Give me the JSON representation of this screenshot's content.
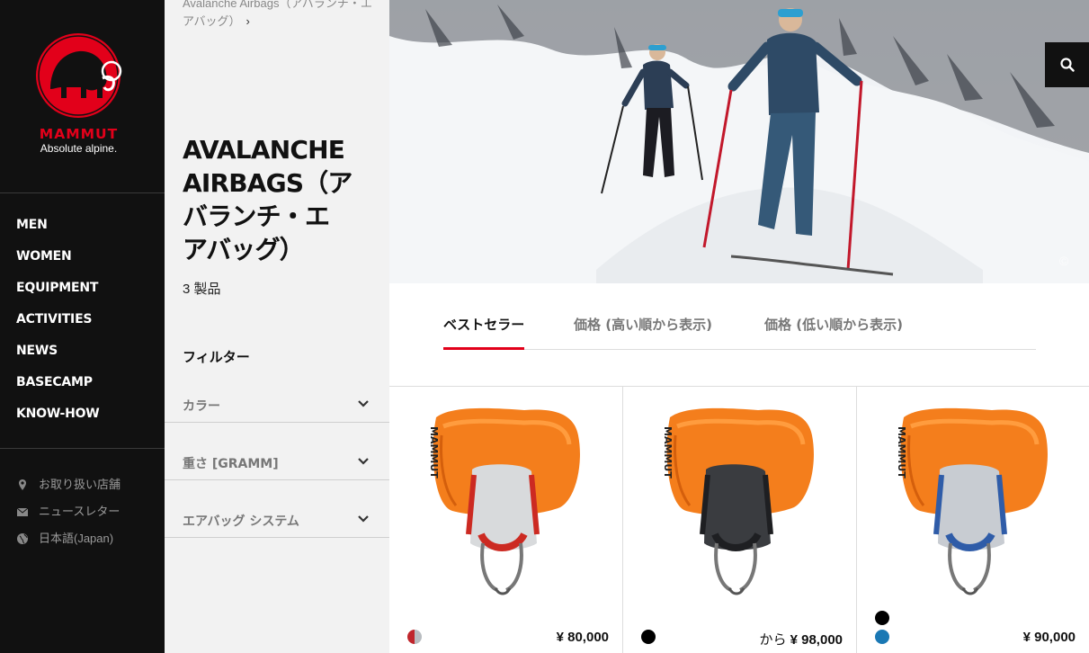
{
  "brand": {
    "name": "MAMMUT",
    "tagline": "Absolute alpine."
  },
  "nav": [
    "MEN",
    "WOMEN",
    "EQUIPMENT",
    "ACTIVITIES",
    "NEWS",
    "BASECAMP",
    "KNOW-HOW"
  ],
  "utility": [
    {
      "label": "お取り扱い店舗",
      "icon": "location-pin-icon"
    },
    {
      "label": "ニュースレター",
      "icon": "envelope-icon"
    },
    {
      "label": "日本語(Japan)",
      "icon": "globe-icon"
    }
  ],
  "breadcrumb": {
    "line1": "Avalanche Airbags（アバランチ・エ",
    "line2": "アバッグ）"
  },
  "category": {
    "title_line1": "AVALANCHE",
    "title_line2": "AIRBAGS（ア",
    "title_line3": "バランチ・エ",
    "title_line4": "アバッグ）",
    "count": "3 製品"
  },
  "filters": {
    "heading": "フィルター",
    "facets": [
      "カラー",
      "重さ [GRAMM]",
      "エアバッグ システム"
    ]
  },
  "hero": {
    "copyright": "©"
  },
  "sort": {
    "tabs": [
      "ベストセラー",
      "価格 (高い順から表示)",
      "価格 (低い順から表示)"
    ],
    "active": 0
  },
  "products": [
    {
      "price": "¥ 80,000",
      "prefix": "",
      "harness": "#d8dadc",
      "accent": "#cc2a22",
      "swatches": [
        "#c0262c|#b8bcc0"
      ]
    },
    {
      "price": "¥ 98,000",
      "prefix": "から ",
      "harness": "#3a3c40",
      "accent": "#1e1f22",
      "swatches": [
        "#000000"
      ]
    },
    {
      "price": "¥ 90,000",
      "prefix": "",
      "harness": "#c8ccd2",
      "accent": "#2f5ca8",
      "swatches": [
        "#000000",
        "#1a78b4"
      ]
    }
  ],
  "colors": {
    "accent": "#e2001a",
    "sidebar": "#111111",
    "filter_bg": "#f2f2f2"
  }
}
